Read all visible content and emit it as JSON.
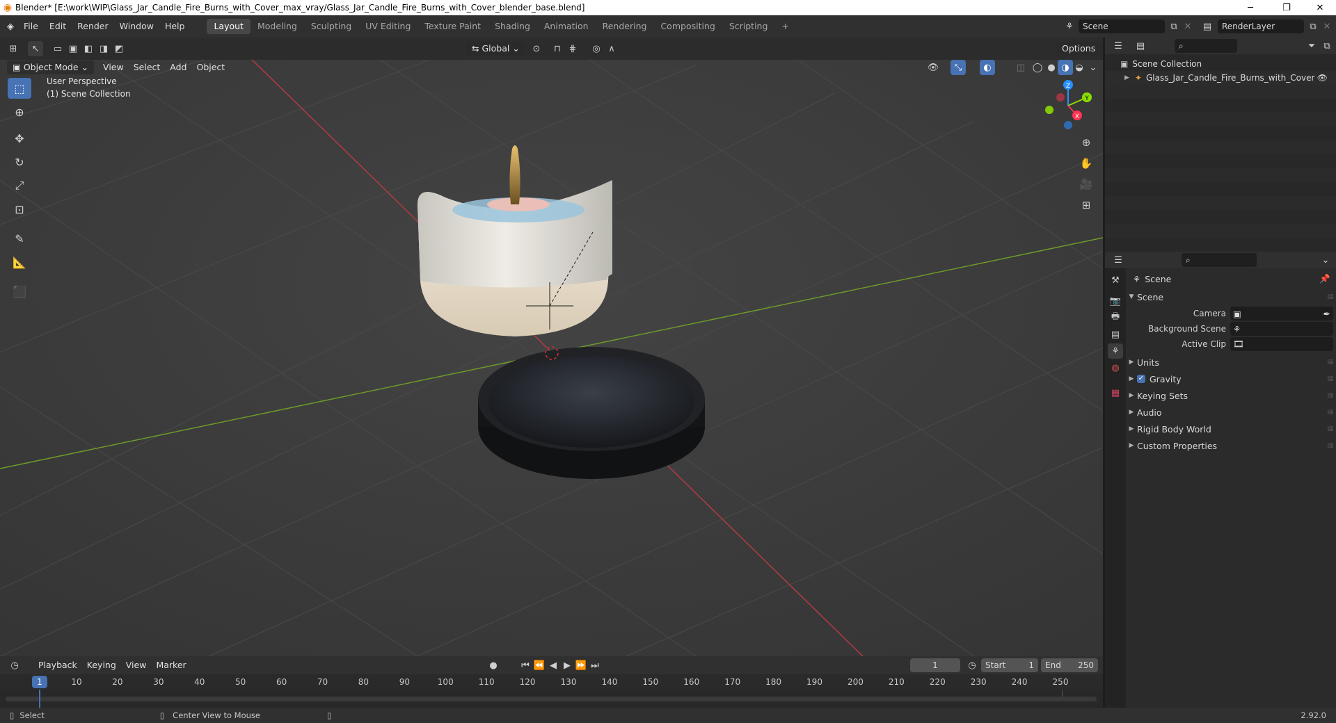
{
  "window": {
    "title": "Blender* [E:\\work\\WIP\\Glass_Jar_Candle_Fire_Burns_with_Cover_max_vray/Glass_Jar_Candle_Fire_Burns_with_Cover_blender_base.blend]",
    "minimize": "─",
    "restore": "❐",
    "close": "✕"
  },
  "menu": {
    "items": [
      "File",
      "Edit",
      "Render",
      "Window",
      "Help"
    ],
    "workspaces": [
      "Layout",
      "Modeling",
      "Sculpting",
      "UV Editing",
      "Texture Paint",
      "Shading",
      "Animation",
      "Rendering",
      "Compositing",
      "Scripting"
    ],
    "add_tab": "+",
    "scene_name": "Scene",
    "view_layer": "RenderLayer"
  },
  "viewport": {
    "orientation": "Global",
    "options": "Options",
    "mode": "Object Mode",
    "menus": [
      "View",
      "Select",
      "Add",
      "Object"
    ],
    "overlay_text_line1": "User Perspective",
    "overlay_text_line2": "(1) Scene Collection",
    "gizmo_x": "X",
    "gizmo_y": "Y",
    "gizmo_z": "Z"
  },
  "timeline": {
    "menus": [
      "Playback",
      "Keying",
      "View",
      "Marker"
    ],
    "current_frame": "1",
    "start_label": "Start",
    "start_value": "1",
    "end_label": "End",
    "end_value": "250",
    "ticks": [
      "1",
      "10",
      "20",
      "30",
      "40",
      "50",
      "60",
      "70",
      "80",
      "90",
      "100",
      "110",
      "120",
      "130",
      "140",
      "150",
      "160",
      "170",
      "180",
      "190",
      "200",
      "210",
      "220",
      "230",
      "240",
      "250"
    ]
  },
  "status": {
    "select": "Select",
    "center_view": "Center View to Mouse",
    "version": "2.92.0"
  },
  "outliner": {
    "root": "Scene Collection",
    "items": [
      "Glass_Jar_Candle_Fire_Burns_with_Cover"
    ]
  },
  "properties": {
    "context": "Scene",
    "panel_title": "Scene",
    "fields": [
      {
        "label": "Camera"
      },
      {
        "label": "Background Scene"
      },
      {
        "label": "Active Clip"
      }
    ],
    "subpanels": [
      "Units",
      "Gravity",
      "Keying Sets",
      "Audio",
      "Rigid Body World",
      "Custom Properties"
    ],
    "gravity_checked": true
  },
  "colors": {
    "accent": "#4772b3",
    "x_axis": "#ff3352",
    "y_axis": "#8bdc00",
    "z_axis": "#2890ff",
    "viewport_bg": "#3d3d3d"
  }
}
